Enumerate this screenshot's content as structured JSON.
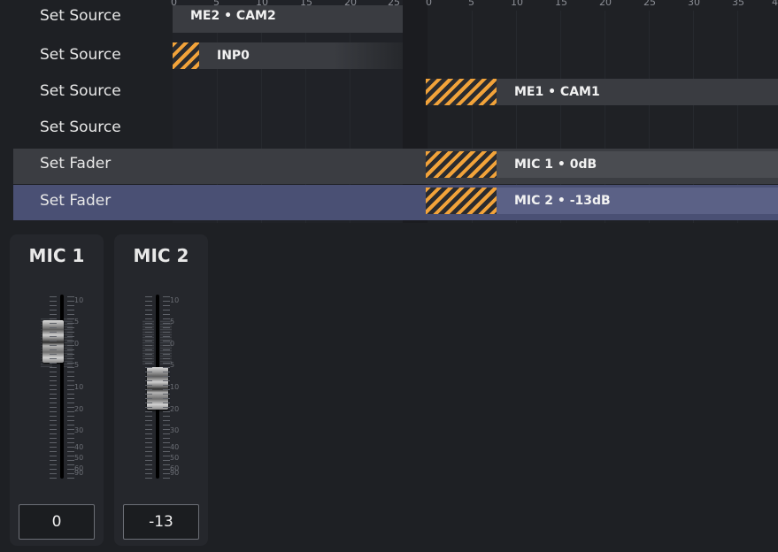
{
  "rulers": {
    "left_ticks": [
      "0",
      "5",
      "10",
      "15",
      "20",
      "25"
    ],
    "right_ticks": [
      "0",
      "5",
      "10",
      "15",
      "20",
      "25",
      "30",
      "35",
      "4"
    ]
  },
  "rows": [
    {
      "label": "Set Source",
      "state": "normal"
    },
    {
      "label": "Set Source",
      "state": "normal"
    },
    {
      "label": "Set Source",
      "state": "normal"
    },
    {
      "label": "Set Source",
      "state": "normal"
    },
    {
      "label": "Set Fader",
      "state": "hover"
    },
    {
      "label": "Set Fader",
      "state": "selected"
    }
  ],
  "clips": [
    {
      "text": "ME2 • CAM2",
      "row": 0
    },
    {
      "text": "INP0",
      "row": 1
    },
    {
      "text": "ME1 • CAM1",
      "row": 2
    },
    {
      "text": "MIC 1 • 0dB",
      "row": 4
    },
    {
      "text": "MIC 2 • -13dB",
      "row": 5
    }
  ],
  "mixer": {
    "scale_labels": [
      "10",
      "5",
      "0",
      "5",
      "10",
      "20",
      "30",
      "40",
      "50",
      "60",
      "90"
    ],
    "strips": [
      {
        "name": "MIC 1",
        "value": "0",
        "level_db": 0
      },
      {
        "name": "MIC 2",
        "value": "-13",
        "level_db": -13
      }
    ]
  },
  "colors": {
    "background": "#1e2024",
    "selected_row": "#4a5074",
    "hover_row": "#3b3d42",
    "hatch_accent": "#f2a33a",
    "clip_fill": "#3a3c41",
    "selected_clip_fill": "#5b6186"
  }
}
